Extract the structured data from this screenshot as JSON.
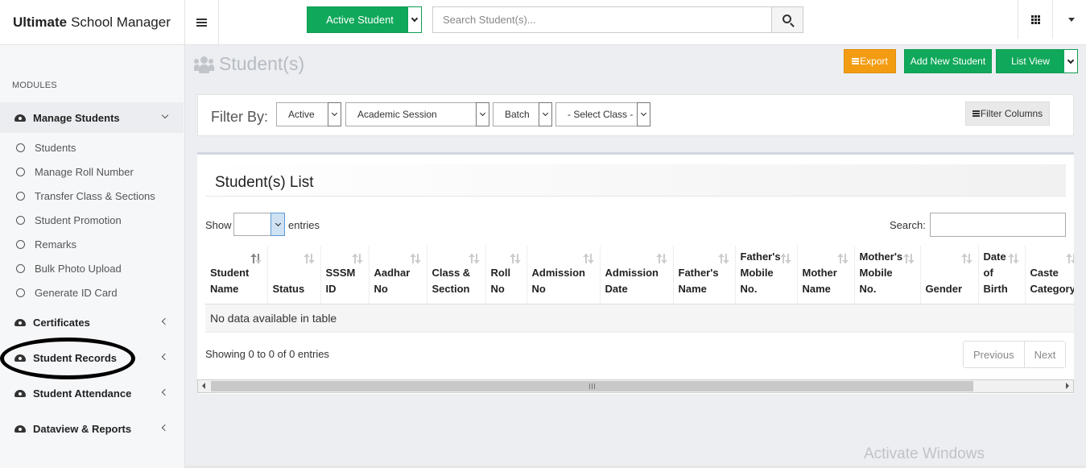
{
  "app": {
    "brand_bold": "Ultimate",
    "brand_rest": "School Manager"
  },
  "topbar": {
    "active_button_label": "Active Student",
    "search_placeholder": "Search Student(s)..."
  },
  "sidebar": {
    "modules_label": "MODULES",
    "groups": [
      {
        "label": "Manage Students",
        "expanded": true,
        "items": [
          "Students",
          "Manage Roll Number",
          "Transfer Class & Sections",
          "Student Promotion",
          "Remarks",
          "Bulk Photo Upload",
          "Generate ID Card"
        ]
      },
      {
        "label": "Certificates",
        "expanded": false
      },
      {
        "label": "Student Records",
        "expanded": false,
        "circled": true
      },
      {
        "label": "Student Attendance",
        "expanded": false
      },
      {
        "label": "Dataview & Reports",
        "expanded": false
      }
    ]
  },
  "page": {
    "title": "Student(s)",
    "export_label": "Export",
    "add_label": "Add New Student",
    "list_view_label": "List View"
  },
  "filter": {
    "label": "Filter By:",
    "status_value": "Active",
    "session_value": "Academic Session",
    "batch_value": "Batch",
    "class_value": "- Select Class -",
    "filter_columns_label": "Filter Columns"
  },
  "list": {
    "title": "Student(s) List",
    "show_label": "Show",
    "entries_label": "entries",
    "search_label": "Search:",
    "columns": [
      [
        "Student",
        "Name"
      ],
      [
        "Status"
      ],
      [
        "SSSM",
        "ID"
      ],
      [
        "Aadhar",
        "No"
      ],
      [
        "Class &",
        "Section"
      ],
      [
        "Roll",
        "No"
      ],
      [
        "Admission",
        "No"
      ],
      [
        "Admission",
        "Date"
      ],
      [
        "Father's",
        "Name"
      ],
      [
        "Father's",
        "Mobile",
        "No."
      ],
      [
        "Mother",
        "Name"
      ],
      [
        "Mother's",
        "Mobile",
        "No."
      ],
      [
        "Gender"
      ],
      [
        "Date",
        "of",
        "Birth"
      ],
      [
        "Caste",
        "Category"
      ]
    ],
    "empty_text": "No data available in table",
    "info_text": "Showing 0 to 0 of 0 entries",
    "previous_label": "Previous",
    "next_label": "Next"
  },
  "watermark": "Activate Windows"
}
